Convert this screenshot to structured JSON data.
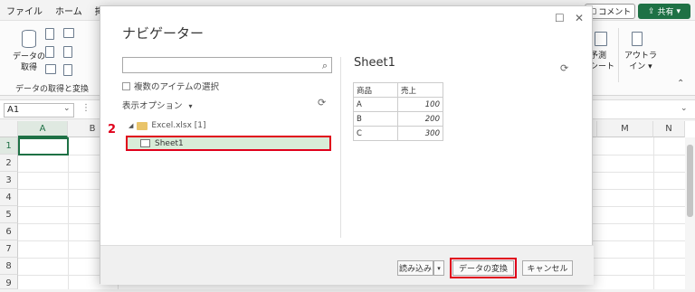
{
  "ribbon": {
    "tabs": [
      "ファイル",
      "ホーム",
      "挿入"
    ],
    "comment_label": "コメント",
    "share_label": "共有",
    "get_data_label": "データの",
    "get_data_label2": "取得",
    "group_label": "データの取得と変換",
    "forecast_label": "予測",
    "forecast_label2": "シート",
    "outline_label": "アウトラ",
    "outline_label2": "イン"
  },
  "formula_bar": {
    "name_box": "A1"
  },
  "grid": {
    "columns": [
      "A",
      "B",
      "M",
      "N"
    ],
    "rows": [
      "1",
      "2",
      "3",
      "4",
      "5",
      "6",
      "7",
      "8",
      "9"
    ]
  },
  "dialog": {
    "title": "ナビゲーター",
    "search_placeholder": "",
    "multi_select_label": "複数のアイテムの選択",
    "display_options_label": "表示オプション",
    "file_node": "Excel.xlsx [1]",
    "sheet_node": "Sheet1",
    "step_number": "2",
    "preview": {
      "title": "Sheet1",
      "headers": [
        "商品",
        "売上"
      ],
      "rows": [
        [
          "A",
          "100"
        ],
        [
          "B",
          "200"
        ],
        [
          "C",
          "300"
        ]
      ]
    },
    "load_button": "読み込み",
    "transform_button": "データの変換",
    "cancel_button": "キャンセル"
  }
}
